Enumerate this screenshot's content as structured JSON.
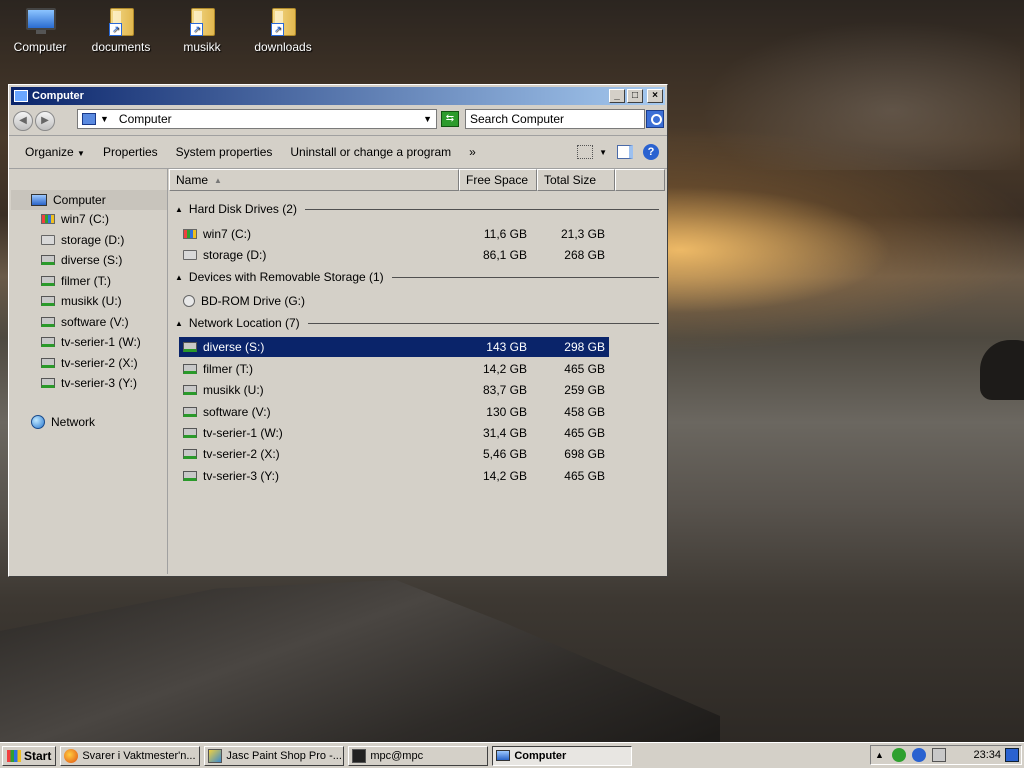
{
  "desktop": {
    "icons": [
      {
        "label": "Computer"
      },
      {
        "label": "documents"
      },
      {
        "label": "musikk"
      },
      {
        "label": "downloads"
      }
    ]
  },
  "window": {
    "title": "Computer",
    "controls": {
      "minimize": "_",
      "maximize": "□",
      "close": "×"
    },
    "address": "Computer",
    "search_placeholder": "Search Computer",
    "toolbar": {
      "organize": "Organize",
      "properties": "Properties",
      "system_properties": "System properties",
      "uninstall": "Uninstall or change a program",
      "more": "»"
    },
    "nav": {
      "computer": "Computer",
      "drives": [
        "win7 (C:)",
        "storage (D:)",
        "diverse (S:)",
        "filmer (T:)",
        "musikk (U:)",
        "software (V:)",
        "tv-serier-1 (W:)",
        "tv-serier-2 (X:)",
        "tv-serier-3 (Y:)"
      ],
      "network": "Network"
    },
    "columns": {
      "name": "Name",
      "free": "Free Space",
      "total": "Total Size"
    },
    "groups": [
      {
        "title": "Hard Disk Drives (2)",
        "items": [
          {
            "name": "win7 (C:)",
            "free": "11,6 GB",
            "total": "21,3 GB",
            "icon": "windows-drive-icon"
          },
          {
            "name": "storage (D:)",
            "free": "86,1 GB",
            "total": "268 GB",
            "icon": "hard-drive-icon"
          }
        ]
      },
      {
        "title": "Devices with Removable Storage (1)",
        "items": [
          {
            "name": "BD-ROM Drive (G:)",
            "free": "",
            "total": "",
            "icon": "optical-drive-icon"
          }
        ]
      },
      {
        "title": "Network Location (7)",
        "items": [
          {
            "name": "diverse (S:)",
            "free": "143 GB",
            "total": "298 GB",
            "icon": "network-drive-icon",
            "selected": true
          },
          {
            "name": "filmer (T:)",
            "free": "14,2 GB",
            "total": "465 GB",
            "icon": "network-drive-icon"
          },
          {
            "name": "musikk (U:)",
            "free": "83,7 GB",
            "total": "259 GB",
            "icon": "network-drive-icon"
          },
          {
            "name": "software (V:)",
            "free": "130 GB",
            "total": "458 GB",
            "icon": "network-drive-icon"
          },
          {
            "name": "tv-serier-1 (W:)",
            "free": "31,4 GB",
            "total": "465 GB",
            "icon": "network-drive-icon"
          },
          {
            "name": "tv-serier-2 (X:)",
            "free": "5,46 GB",
            "total": "698 GB",
            "icon": "network-drive-icon"
          },
          {
            "name": "tv-serier-3 (Y:)",
            "free": "14,2 GB",
            "total": "465 GB",
            "icon": "network-drive-icon"
          }
        ]
      }
    ]
  },
  "taskbar": {
    "start": "Start",
    "tasks": [
      "Svarer i Vaktmester'n...",
      "Jasc Paint Shop Pro -...",
      "mpc@mpc",
      "Computer"
    ],
    "clock": "23:34"
  },
  "colors": {
    "title_start": "#0a246a",
    "title_end": "#a6caf0",
    "selection": "#0a246a",
    "chrome": "#d4d0c8"
  }
}
